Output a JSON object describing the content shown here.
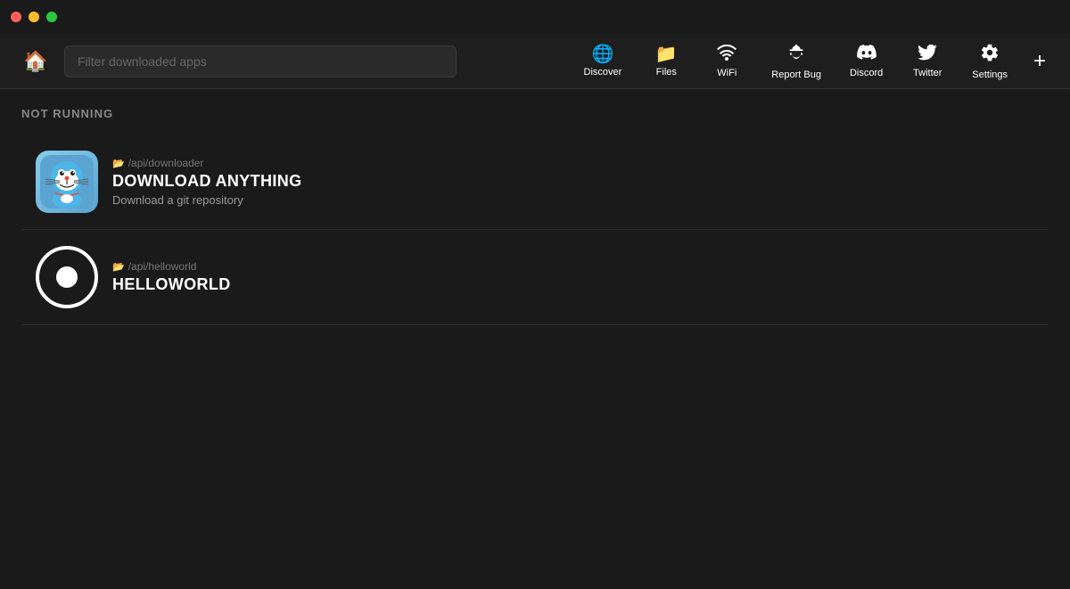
{
  "titlebar": {
    "close_label": "close",
    "minimize_label": "minimize",
    "maximize_label": "maximize"
  },
  "toolbar": {
    "home_label": "Home",
    "search_placeholder": "Filter downloaded apps",
    "nav_items": [
      {
        "id": "discover",
        "label": "Discover",
        "icon": "🌐"
      },
      {
        "id": "files",
        "label": "Files",
        "icon": "📁"
      },
      {
        "id": "wifi",
        "label": "WiFi",
        "icon": "📶"
      },
      {
        "id": "report-bug",
        "label": "Report Bug",
        "icon": "🐛"
      },
      {
        "id": "discord",
        "label": "Discord",
        "icon": "💬"
      },
      {
        "id": "twitter",
        "label": "Twitter",
        "icon": "🐦"
      },
      {
        "id": "settings",
        "label": "Settings",
        "icon": "⚙️"
      }
    ],
    "add_label": "+"
  },
  "main": {
    "section_label": "NOT RUNNING",
    "apps": [
      {
        "id": "download-anything",
        "path": "/api/downloader",
        "name": "DOWNLOAD ANYTHING",
        "description": "Download a git repository",
        "icon_type": "doraemon"
      },
      {
        "id": "helloworld",
        "path": "/api/helloworld",
        "name": "HELLOWORLD",
        "description": "",
        "icon_type": "circle"
      }
    ]
  }
}
